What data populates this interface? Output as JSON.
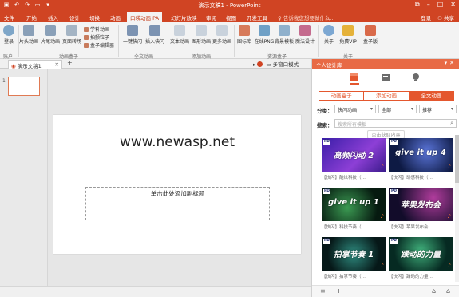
{
  "titlebar": {
    "title": "演示文稿1 - PowerPoint",
    "qa_icons": [
      "save-icon",
      "undo-icon",
      "redo-icon",
      "presentation-icon",
      "dropdown-icon"
    ],
    "controls": [
      "restore-icon",
      "minimize-icon",
      "maximize-icon",
      "close-icon"
    ]
  },
  "tabs": {
    "items": [
      "文件",
      "开始",
      "插入",
      "设计",
      "切换",
      "动画",
      "口袋动画 PA",
      "幻灯片放映",
      "审阅",
      "视图",
      "开发工具"
    ],
    "active": "口袋动画 PA",
    "tell_me": "告诉我您想要做什么...",
    "login": "登录",
    "share": "共享"
  },
  "ribbon": {
    "buttons": {
      "login": "登录",
      "pianto": "片头动画",
      "pianwei": "片尾动画",
      "yemian": "页面转场",
      "yijian": "一键快闪",
      "charu": "插入快闪",
      "wenben": "文本动画",
      "tuxing": "图形动画",
      "gengduo": "更多动画",
      "tubiao": "图标库",
      "zaixian": "在线PNG",
      "beijing": "背景模板",
      "moshu": "魔法设计",
      "guanyu": "关于",
      "vip": "免费VIP",
      "hezi": "盒子版"
    },
    "small": {
      "xueke": "学科动画",
      "lizi": "拍颤粒子",
      "bianji": "盒子编辑器"
    },
    "groups": [
      "账户",
      "动画盒子",
      "全文动画",
      "添加动画",
      "资源盒子",
      "关于"
    ]
  },
  "docstrip": {
    "doc_name": "演示文稿1",
    "add": "+",
    "multi_window": "多窗口模式"
  },
  "thumbs": {
    "number": "1"
  },
  "slide": {
    "title": "www.newasp.net",
    "subtitle_placeholder": "单击此处添加副标题"
  },
  "panel": {
    "title": "个人设计库",
    "tabs": [
      "动画盒子",
      "添加动画",
      "全文动画"
    ],
    "active_tab": "全文动画",
    "filter": {
      "label": "分类：",
      "category": "快闪动画",
      "scope": "全部",
      "sort": "推荐"
    },
    "search": {
      "label": "搜索：",
      "placeholder": "搜索所有模板"
    },
    "hint": "点击获取内容",
    "cards": [
      {
        "text": "高频闪动 2",
        "caption": "【快闪】酷炫科技（…",
        "bg": "#4a2bb0"
      },
      {
        "text": "give it up 4",
        "caption": "【快闪】动感科技（…",
        "bg": "#11204a"
      },
      {
        "text": "give it up 1",
        "caption": "【快闪】科技节奏（…",
        "bg": "#0b2a1d"
      },
      {
        "text": "苹果发布会",
        "caption": "【快闪】苹果发布会…",
        "bg": "#1a1433"
      },
      {
        "text": "拍掌节奏 1",
        "caption": "【快闪】拍掌节奏（…",
        "bg": "#0f2a2a"
      },
      {
        "text": "躁动的力量",
        "caption": "【快闪】躁动的力量…",
        "bg": "#0b2f2a"
      }
    ],
    "bottom_icons": [
      "menu-icon",
      "add-icon",
      "graduation-icon",
      "home-icon"
    ]
  },
  "colors": {
    "accent": "#d04423",
    "panel_accent": "#e4572e"
  }
}
